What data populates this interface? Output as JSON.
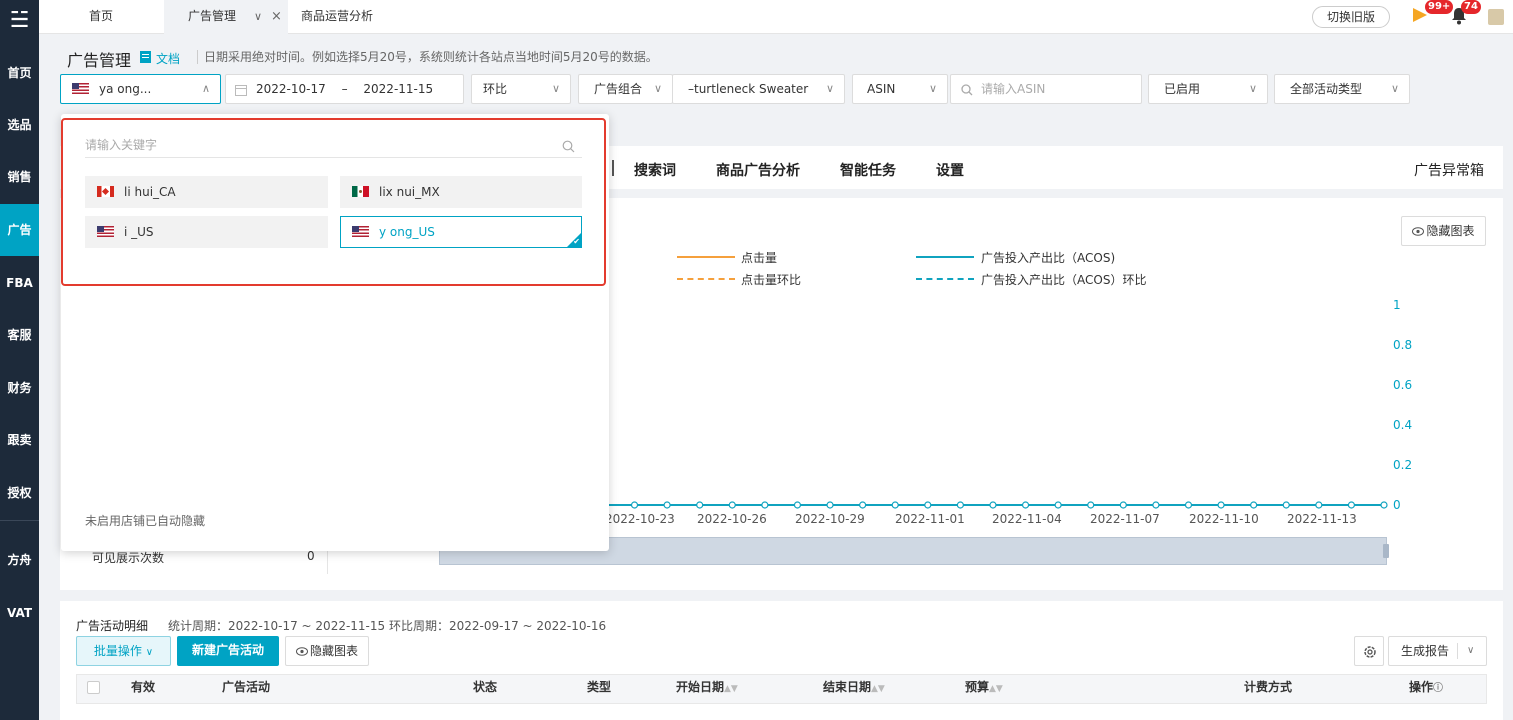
{
  "sidebar": {
    "logo": "☱",
    "items": [
      {
        "label": "首页"
      },
      {
        "label": "选品"
      },
      {
        "label": "销售"
      },
      {
        "label": "广告",
        "active": true
      },
      {
        "label": "FBA"
      },
      {
        "label": "客服"
      },
      {
        "label": "财务"
      },
      {
        "label": "跟卖"
      },
      {
        "label": "授权"
      },
      {
        "label": "方舟"
      },
      {
        "label": "VAT"
      }
    ]
  },
  "tabs": {
    "home": "首页",
    "ads": "广告管理",
    "ops": "商品运营分析",
    "close": "×",
    "chev": "∨"
  },
  "header": {
    "old_version": "切换旧版",
    "flag_badge": "99+",
    "bell_badge": "74"
  },
  "page": {
    "title": "广告管理",
    "doc_link": "文档",
    "hint": "日期采用绝对时间。例如选择5月20号，系统则统计各站点当地时间5月20号的数据。"
  },
  "filters": {
    "store": "ya        ong...",
    "date_start": "2022-10-17",
    "date_sep": "–",
    "date_end": "2022-11-15",
    "compare": "环比",
    "group": "广告组合",
    "product": "–turtleneck Sweater",
    "asin_type": "ASIN",
    "asin_placeholder": "请输入ASIN",
    "status": "已启用",
    "campaign_type": "全部活动类型"
  },
  "subnav": {
    "search_terms": "搜索词",
    "product_ads": "商品广告分析",
    "smart_tasks": "智能任务",
    "settings": "设置",
    "anomaly": "广告异常箱"
  },
  "chart_panel": {
    "hide_chart": "隐藏图表",
    "metric_visible_impressions": "可见展示次数",
    "metric_value": "0"
  },
  "chart_data": {
    "type": "line",
    "x": [
      "2022-10-17",
      "2022-10-18",
      "2022-10-19",
      "2022-10-20",
      "2022-10-21",
      "2022-10-22",
      "2022-10-23",
      "2022-10-24",
      "2022-10-25",
      "2022-10-26",
      "2022-10-27",
      "2022-10-28",
      "2022-10-29",
      "2022-10-30",
      "2022-10-31",
      "2022-11-01",
      "2022-11-02",
      "2022-11-03",
      "2022-11-04",
      "2022-11-05",
      "2022-11-06",
      "2022-11-07",
      "2022-11-08",
      "2022-11-09",
      "2022-11-10",
      "2022-11-11",
      "2022-11-12",
      "2022-11-13",
      "2022-11-14",
      "2022-11-15"
    ],
    "x_tick_labels": [
      "2022-10-23",
      "2022-10-26",
      "2022-10-29",
      "2022-11-01",
      "2022-11-04",
      "2022-11-07",
      "2022-11-10",
      "2022-11-13"
    ],
    "y_ticks": [
      "1",
      "0.8",
      "0.6",
      "0.4",
      "0.2",
      "0"
    ],
    "ylim": [
      0,
      1
    ],
    "legend": [
      {
        "name": "点击量",
        "color": "#f5a03c",
        "style": "solid"
      },
      {
        "name": "点击量环比",
        "color": "#f5a03c",
        "style": "dashed"
      },
      {
        "name": "广告投入产出比（ACOS)",
        "color": "#10a3bf",
        "style": "solid"
      },
      {
        "name": "广告投入产出比（ACOS）环比",
        "color": "#10a3bf",
        "style": "dashed"
      }
    ],
    "series": [
      {
        "name": "广告投入产出比（ACOS)",
        "values": [
          0,
          0,
          0,
          0,
          0,
          0,
          0,
          0,
          0,
          0,
          0,
          0,
          0,
          0,
          0,
          0,
          0,
          0,
          0,
          0,
          0,
          0,
          0,
          0,
          0,
          0,
          0,
          0,
          0,
          0
        ]
      }
    ]
  },
  "campaigns": {
    "title": "广告活动明细",
    "period": "统计周期：2022-10-17 ~ 2022-11-15 环比周期：2022-09-17 ~ 2022-10-16",
    "batch": "批量操作",
    "new_campaign": "新建广告活动",
    "hide_chart": "隐藏图表",
    "report": "生成报告",
    "columns": [
      "有效",
      "广告活动",
      "状态",
      "类型",
      "开始日期",
      "结束日期",
      "预算",
      "计费方式",
      "操作"
    ]
  },
  "dropdown": {
    "search_placeholder": "请输入关键字",
    "options": [
      {
        "label": "li        hui_CA",
        "flag": "ca"
      },
      {
        "label": "lix      nui_MX",
        "flag": "mx"
      },
      {
        "label": "i          _US",
        "flag": "us"
      },
      {
        "label": "y           ong_US",
        "flag": "us",
        "selected": true
      }
    ],
    "footer": "未启用店铺已自动隐藏"
  }
}
